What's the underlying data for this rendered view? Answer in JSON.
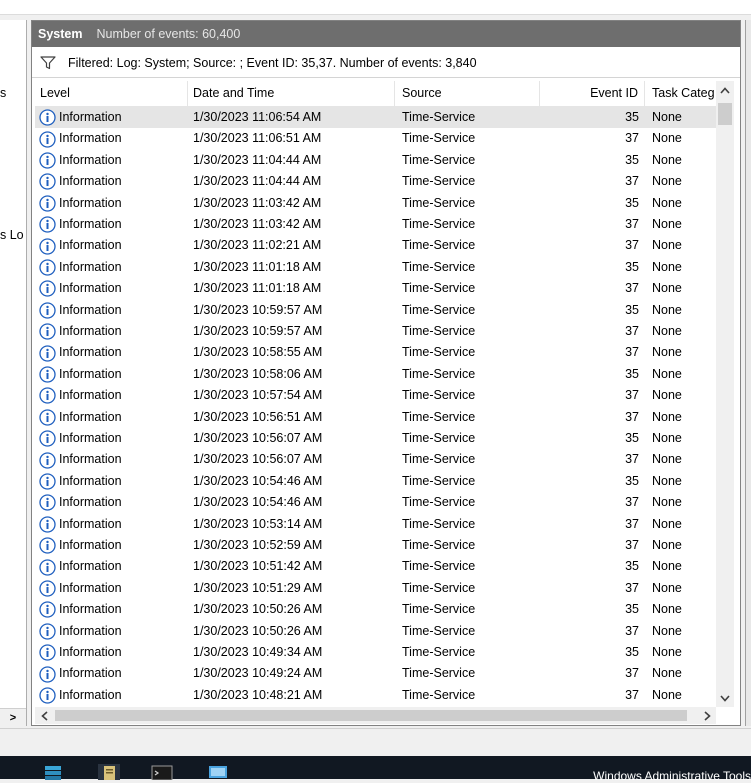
{
  "left_pane": {
    "fragment_1": "s",
    "fragment_2": "s Lo",
    "scroll_right_glyph": ">"
  },
  "title_bar": {
    "log_name": "System",
    "event_count": "Number of events: 60,400"
  },
  "filter_bar": {
    "text": "Filtered: Log: System; Source: ; Event ID: 35,37. Number of events: 3,840"
  },
  "columns": {
    "level": "Level",
    "date_time": "Date and Time",
    "source": "Source",
    "event_id": "Event ID",
    "task_category": "Task Categ"
  },
  "events": [
    {
      "level": "Information",
      "date": "1/30/2023 11:06:54 AM",
      "source": "Time-Service",
      "id": "35",
      "task": "None"
    },
    {
      "level": "Information",
      "date": "1/30/2023 11:06:51 AM",
      "source": "Time-Service",
      "id": "37",
      "task": "None"
    },
    {
      "level": "Information",
      "date": "1/30/2023 11:04:44 AM",
      "source": "Time-Service",
      "id": "35",
      "task": "None"
    },
    {
      "level": "Information",
      "date": "1/30/2023 11:04:44 AM",
      "source": "Time-Service",
      "id": "37",
      "task": "None"
    },
    {
      "level": "Information",
      "date": "1/30/2023 11:03:42 AM",
      "source": "Time-Service",
      "id": "35",
      "task": "None"
    },
    {
      "level": "Information",
      "date": "1/30/2023 11:03:42 AM",
      "source": "Time-Service",
      "id": "37",
      "task": "None"
    },
    {
      "level": "Information",
      "date": "1/30/2023 11:02:21 AM",
      "source": "Time-Service",
      "id": "37",
      "task": "None"
    },
    {
      "level": "Information",
      "date": "1/30/2023 11:01:18 AM",
      "source": "Time-Service",
      "id": "35",
      "task": "None"
    },
    {
      "level": "Information",
      "date": "1/30/2023 11:01:18 AM",
      "source": "Time-Service",
      "id": "37",
      "task": "None"
    },
    {
      "level": "Information",
      "date": "1/30/2023 10:59:57 AM",
      "source": "Time-Service",
      "id": "35",
      "task": "None"
    },
    {
      "level": "Information",
      "date": "1/30/2023 10:59:57 AM",
      "source": "Time-Service",
      "id": "37",
      "task": "None"
    },
    {
      "level": "Information",
      "date": "1/30/2023 10:58:55 AM",
      "source": "Time-Service",
      "id": "37",
      "task": "None"
    },
    {
      "level": "Information",
      "date": "1/30/2023 10:58:06 AM",
      "source": "Time-Service",
      "id": "35",
      "task": "None"
    },
    {
      "level": "Information",
      "date": "1/30/2023 10:57:54 AM",
      "source": "Time-Service",
      "id": "37",
      "task": "None"
    },
    {
      "level": "Information",
      "date": "1/30/2023 10:56:51 AM",
      "source": "Time-Service",
      "id": "37",
      "task": "None"
    },
    {
      "level": "Information",
      "date": "1/30/2023 10:56:07 AM",
      "source": "Time-Service",
      "id": "35",
      "task": "None"
    },
    {
      "level": "Information",
      "date": "1/30/2023 10:56:07 AM",
      "source": "Time-Service",
      "id": "37",
      "task": "None"
    },
    {
      "level": "Information",
      "date": "1/30/2023 10:54:46 AM",
      "source": "Time-Service",
      "id": "35",
      "task": "None"
    },
    {
      "level": "Information",
      "date": "1/30/2023 10:54:46 AM",
      "source": "Time-Service",
      "id": "37",
      "task": "None"
    },
    {
      "level": "Information",
      "date": "1/30/2023 10:53:14 AM",
      "source": "Time-Service",
      "id": "37",
      "task": "None"
    },
    {
      "level": "Information",
      "date": "1/30/2023 10:52:59 AM",
      "source": "Time-Service",
      "id": "37",
      "task": "None"
    },
    {
      "level": "Information",
      "date": "1/30/2023 10:51:42 AM",
      "source": "Time-Service",
      "id": "35",
      "task": "None"
    },
    {
      "level": "Information",
      "date": "1/30/2023 10:51:29 AM",
      "source": "Time-Service",
      "id": "37",
      "task": "None"
    },
    {
      "level": "Information",
      "date": "1/30/2023 10:50:26 AM",
      "source": "Time-Service",
      "id": "35",
      "task": "None"
    },
    {
      "level": "Information",
      "date": "1/30/2023 10:50:26 AM",
      "source": "Time-Service",
      "id": "37",
      "task": "None"
    },
    {
      "level": "Information",
      "date": "1/30/2023 10:49:34 AM",
      "source": "Time-Service",
      "id": "35",
      "task": "None"
    },
    {
      "level": "Information",
      "date": "1/30/2023 10:49:24 AM",
      "source": "Time-Service",
      "id": "37",
      "task": "None"
    },
    {
      "level": "Information",
      "date": "1/30/2023 10:48:21 AM",
      "source": "Time-Service",
      "id": "37",
      "task": "None"
    }
  ],
  "selected_row": 0,
  "icons": {
    "level": "information-icon",
    "filter": "filter-funnel-icon"
  },
  "colors": {
    "title_bar": "#6e6e6e",
    "selected_row": "#e5e5e5",
    "info_icon": "#1f5fbf",
    "taskbar": "#111822"
  },
  "taskbar": {
    "app_title": "Windows Administrative Tools"
  }
}
